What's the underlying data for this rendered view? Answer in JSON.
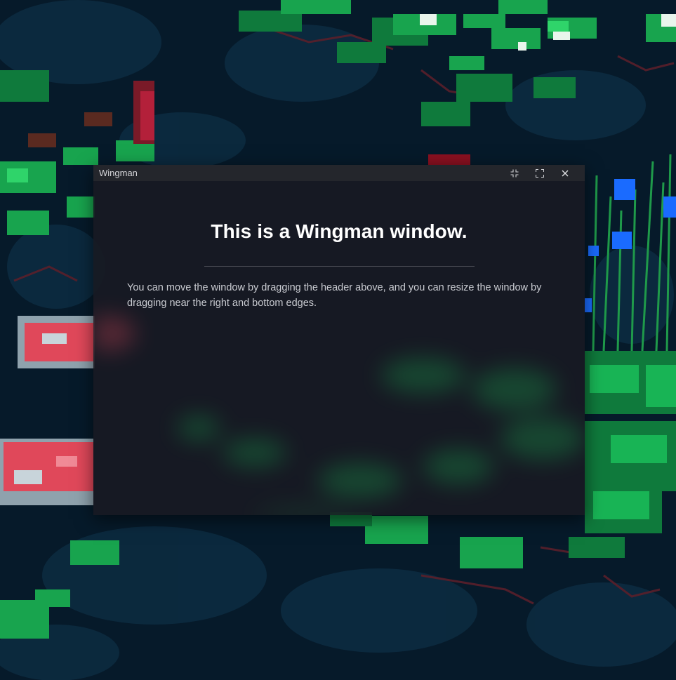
{
  "window": {
    "title": "Wingman",
    "controls": {
      "minimize_icon": "collapse-arrows-icon",
      "maximize_icon": "fullscreen-icon",
      "close_icon": "close-icon"
    }
  },
  "content": {
    "heading": "This is a Wingman window.",
    "description": "You can move the window by dragging the header above, and you can resize the window by dragging near the right and bottom edges."
  },
  "colors": {
    "water_dark": "#061a2a",
    "water_mid": "#0d2b40",
    "lily_green": "#1aa84e",
    "lily_light": "#22c55e",
    "koi_red": "#e0485a",
    "flower_blue": "#1a6bff",
    "window_bg": "#18191f",
    "titlebar_bg": "#24262c"
  }
}
